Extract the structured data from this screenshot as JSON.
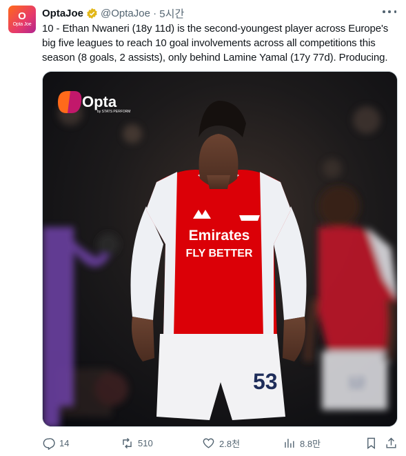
{
  "author": {
    "display_name": "OptaJoe",
    "handle": "@OptaJoe",
    "time": "5시간",
    "avatar_text": "Opta Joe",
    "verified": true
  },
  "tweet": {
    "text": "10 - Ethan Nwaneri (18y 11d) is the second-youngest player across Europe's big five leagues to reach 10 goal involvements across all competitions this season (8 goals, 2 assists), only behind Lamine Yamal (17y 77d). Producing."
  },
  "media": {
    "watermark_brand": "Opta",
    "watermark_sub": "by STATS PERFORM",
    "sponsor_main": "Emirates",
    "sponsor_sub": "FLY BETTER",
    "shirt_number": "53",
    "bg_player_number": "12"
  },
  "actions": {
    "replies": "14",
    "retweets": "510",
    "likes": "2.8천",
    "views": "8.8만"
  },
  "colors": {
    "arsenal_red": "#db0007",
    "verified_gold": "#e2b719",
    "muted": "#536471"
  }
}
